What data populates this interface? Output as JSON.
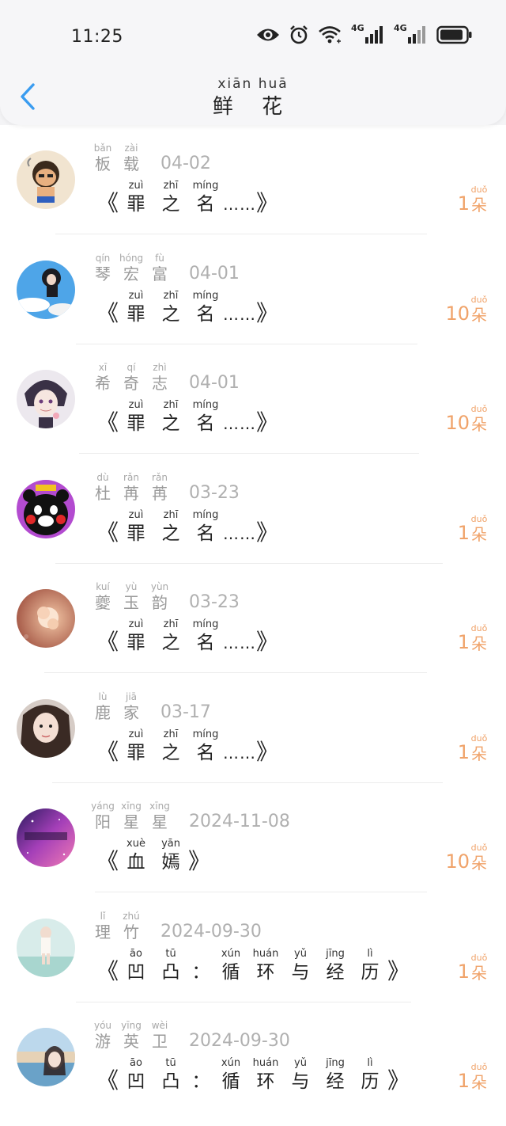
{
  "status_bar": {
    "time": "11:25",
    "icons": [
      "eye-icon",
      "alarm-icon",
      "wifi-icon",
      "signal-4g-icon",
      "signal-4g-icon",
      "battery-icon"
    ],
    "network_labels": [
      "4G",
      "4G"
    ]
  },
  "header": {
    "back_icon": "chevron-left-icon",
    "title_pinyin": "xiān huā",
    "title": "鲜 花",
    "accent_color": "#3a9cf0"
  },
  "count_color": "#f0a36a",
  "items": [
    {
      "name": [
        {
          "py": "bǎn",
          "cn": "板"
        },
        {
          "py": "zài",
          "cn": "载"
        }
      ],
      "date": "04-02",
      "book": [
        {
          "py": "zuì",
          "cn": "罪"
        },
        {
          "py": "zhī",
          "cn": "之"
        },
        {
          "py": "míng",
          "cn": "名"
        }
      ],
      "book_suffix": "……",
      "count": "1",
      "unit_py": "duǒ",
      "unit": "朵",
      "avatar": "cartoon-boy-avatar"
    },
    {
      "name": [
        {
          "py": "qín",
          "cn": "琴"
        },
        {
          "py": "hóng",
          "cn": "宏"
        },
        {
          "py": "fù",
          "cn": "富"
        }
      ],
      "date": "04-01",
      "book": [
        {
          "py": "zuì",
          "cn": "罪"
        },
        {
          "py": "zhī",
          "cn": "之"
        },
        {
          "py": "míng",
          "cn": "名"
        }
      ],
      "book_suffix": "……",
      "count": "10",
      "unit_py": "duǒ",
      "unit": "朵",
      "avatar": "sky-girl-avatar"
    },
    {
      "name": [
        {
          "py": "xī",
          "cn": "希"
        },
        {
          "py": "qí",
          "cn": "奇"
        },
        {
          "py": "zhì",
          "cn": "志"
        }
      ],
      "date": "04-01",
      "book": [
        {
          "py": "zuì",
          "cn": "罪"
        },
        {
          "py": "zhī",
          "cn": "之"
        },
        {
          "py": "míng",
          "cn": "名"
        }
      ],
      "book_suffix": "……",
      "count": "10",
      "unit_py": "duǒ",
      "unit": "朵",
      "avatar": "anime-boy-avatar"
    },
    {
      "name": [
        {
          "py": "dù",
          "cn": "杜"
        },
        {
          "py": "rǎn",
          "cn": "苒"
        },
        {
          "py": "rǎn",
          "cn": "苒"
        }
      ],
      "date": "03-23",
      "book": [
        {
          "py": "zuì",
          "cn": "罪"
        },
        {
          "py": "zhī",
          "cn": "之"
        },
        {
          "py": "míng",
          "cn": "名"
        }
      ],
      "book_suffix": "……",
      "count": "1",
      "unit_py": "duǒ",
      "unit": "朵",
      "avatar": "kumamon-avatar"
    },
    {
      "name": [
        {
          "py": "kuí",
          "cn": "夔"
        },
        {
          "py": "yù",
          "cn": "玉"
        },
        {
          "py": "yùn",
          "cn": "韵"
        }
      ],
      "date": "03-23",
      "book": [
        {
          "py": "zuì",
          "cn": "罪"
        },
        {
          "py": "zhī",
          "cn": "之"
        },
        {
          "py": "míng",
          "cn": "名"
        }
      ],
      "book_suffix": "……",
      "count": "1",
      "unit_py": "duǒ",
      "unit": "朵",
      "avatar": "flower-avatar"
    },
    {
      "name": [
        {
          "py": "lù",
          "cn": "鹿"
        },
        {
          "py": "jiā",
          "cn": "家"
        }
      ],
      "date": "03-17",
      "book": [
        {
          "py": "zuì",
          "cn": "罪"
        },
        {
          "py": "zhī",
          "cn": "之"
        },
        {
          "py": "míng",
          "cn": "名"
        }
      ],
      "book_suffix": "……",
      "count": "1",
      "unit_py": "duǒ",
      "unit": "朵",
      "avatar": "girl-portrait-avatar"
    },
    {
      "name": [
        {
          "py": "yáng",
          "cn": "阳"
        },
        {
          "py": "xīng",
          "cn": "星"
        },
        {
          "py": "xīng",
          "cn": "星"
        }
      ],
      "date": "2024-11-08",
      "book": [
        {
          "py": "xuè",
          "cn": "血"
        },
        {
          "py": "yān",
          "cn": "嫣"
        }
      ],
      "book_suffix": "",
      "count": "10",
      "unit_py": "duǒ",
      "unit": "朵",
      "avatar": "galaxy-avatar"
    },
    {
      "name": [
        {
          "py": "lǐ",
          "cn": "理"
        },
        {
          "py": "zhú",
          "cn": "竹"
        }
      ],
      "date": "2024-09-30",
      "book": [
        {
          "py": "āo",
          "cn": "凹"
        },
        {
          "py": "tū",
          "cn": "凸"
        },
        {
          "py": "",
          "cn": "："
        },
        {
          "py": "xún",
          "cn": "循"
        },
        {
          "py": "huán",
          "cn": "环"
        },
        {
          "py": "yǔ",
          "cn": "与"
        },
        {
          "py": "jīng",
          "cn": "经"
        },
        {
          "py": "lì",
          "cn": "历"
        }
      ],
      "book_suffix": "",
      "count": "1",
      "unit_py": "duǒ",
      "unit": "朵",
      "avatar": "beach-girl-avatar"
    },
    {
      "name": [
        {
          "py": "yóu",
          "cn": "游"
        },
        {
          "py": "yīng",
          "cn": "英"
        },
        {
          "py": "wèi",
          "cn": "卫"
        }
      ],
      "date": "2024-09-30",
      "book": [
        {
          "py": "āo",
          "cn": "凹"
        },
        {
          "py": "tū",
          "cn": "凸"
        },
        {
          "py": "",
          "cn": "："
        },
        {
          "py": "xún",
          "cn": "循"
        },
        {
          "py": "huán",
          "cn": "环"
        },
        {
          "py": "yǔ",
          "cn": "与"
        },
        {
          "py": "jīng",
          "cn": "经"
        },
        {
          "py": "lì",
          "cn": "历"
        }
      ],
      "book_suffix": "",
      "count": "1",
      "unit_py": "duǒ",
      "unit": "朵",
      "avatar": "harbor-girl-avatar"
    }
  ]
}
